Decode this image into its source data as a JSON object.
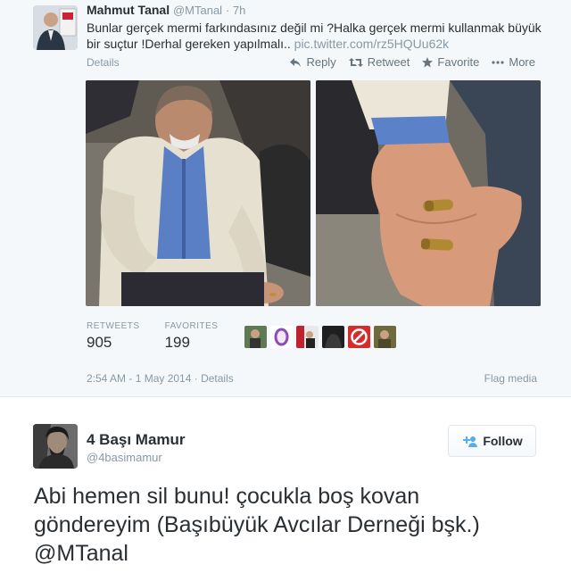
{
  "tweet1": {
    "author_name": "Mahmut Tanal",
    "author_handle": "@MTanal",
    "time_ago": "7h",
    "text": "Bunlar gerçek mermi farkındasınız değil mi ?Halka gerçek mermi kullanmak büyük bir suçtur !Derhal gereken yapılmalı..",
    "link": "pic.twitter.com/rz5HQUu62k",
    "details": "Details",
    "actions": {
      "reply": "Reply",
      "retweet": "Retweet",
      "favorite": "Favorite",
      "more": "More"
    },
    "stats": {
      "retweets_label": "RETWEETS",
      "retweets_value": "905",
      "favorites_label": "FAVORITES",
      "favorites_value": "199"
    },
    "timestamp": "2:54 AM - 1 May 2014 · Details",
    "flag_media": "Flag media"
  },
  "tweet2": {
    "author_name": "4 Başı Mamur",
    "author_handle": "@4basimamur",
    "follow_label": "Follow",
    "text_line1": "Abi hemen sil bunu! çocukla boş kovan",
    "text_line2": "göndereyim (Başıbüyük Avcılar Derneği bşk.)",
    "mention": "@MTanal"
  },
  "colors": {
    "muted": "#8899a6",
    "text": "#292f33",
    "card_bg": "#f5f8fa",
    "follow_icon": "#55acee"
  }
}
